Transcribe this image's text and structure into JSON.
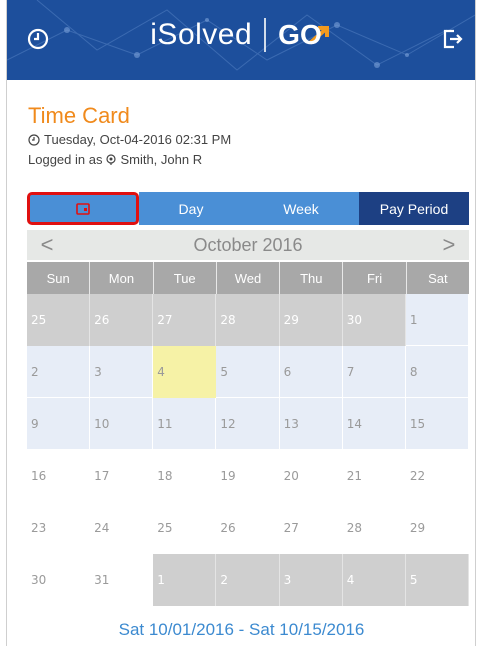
{
  "header": {
    "brand_text": "iSolved",
    "brand_go": "GO",
    "brand_color": "#1d4f9c",
    "left_icon": "clock-icon",
    "right_icon": "logout-icon"
  },
  "page": {
    "title": "Time Card",
    "datetime": "Tuesday, Oct-04-2016 02:31 PM",
    "logged_in_label": "Logged in as",
    "user": "Smith, John R"
  },
  "tabs": [
    {
      "label": "",
      "icon": "calendar-icon"
    },
    {
      "label": "Day"
    },
    {
      "label": "Week"
    },
    {
      "label": "Pay Period"
    }
  ],
  "calendar": {
    "month_label": "October 2016",
    "prev": "<",
    "next": ">",
    "weekdays": [
      "Sun",
      "Mon",
      "Tue",
      "Wed",
      "Thu",
      "Fri",
      "Sat"
    ],
    "weeks": [
      [
        {
          "d": "25",
          "s": "gray"
        },
        {
          "d": "26",
          "s": "gray"
        },
        {
          "d": "27",
          "s": "gray"
        },
        {
          "d": "28",
          "s": "gray"
        },
        {
          "d": "29",
          "s": "gray"
        },
        {
          "d": "30",
          "s": "gray"
        },
        {
          "d": "1",
          "s": "blue"
        }
      ],
      [
        {
          "d": "2",
          "s": "blue"
        },
        {
          "d": "3",
          "s": "blue"
        },
        {
          "d": "4",
          "s": "today"
        },
        {
          "d": "5",
          "s": "blue"
        },
        {
          "d": "6",
          "s": "blue"
        },
        {
          "d": "7",
          "s": "blue"
        },
        {
          "d": "8",
          "s": "blue"
        }
      ],
      [
        {
          "d": "9",
          "s": "blue"
        },
        {
          "d": "10",
          "s": "blue"
        },
        {
          "d": "11",
          "s": "blue"
        },
        {
          "d": "12",
          "s": "blue"
        },
        {
          "d": "13",
          "s": "blue"
        },
        {
          "d": "14",
          "s": "blue"
        },
        {
          "d": "15",
          "s": "blue"
        }
      ],
      [
        {
          "d": "16",
          "s": "white"
        },
        {
          "d": "17",
          "s": "white"
        },
        {
          "d": "18",
          "s": "white"
        },
        {
          "d": "19",
          "s": "white"
        },
        {
          "d": "20",
          "s": "white"
        },
        {
          "d": "21",
          "s": "white"
        },
        {
          "d": "22",
          "s": "white"
        }
      ],
      [
        {
          "d": "23",
          "s": "white"
        },
        {
          "d": "24",
          "s": "white"
        },
        {
          "d": "25",
          "s": "white"
        },
        {
          "d": "26",
          "s": "white"
        },
        {
          "d": "27",
          "s": "white"
        },
        {
          "d": "28",
          "s": "white"
        },
        {
          "d": "29",
          "s": "white"
        }
      ],
      [
        {
          "d": "30",
          "s": "white"
        },
        {
          "d": "31",
          "s": "white"
        },
        {
          "d": "1",
          "s": "gray"
        },
        {
          "d": "2",
          "s": "gray"
        },
        {
          "d": "3",
          "s": "gray"
        },
        {
          "d": "4",
          "s": "gray"
        },
        {
          "d": "5",
          "s": "gray"
        }
      ]
    ]
  },
  "pay_period_range": "Sat 10/01/2016 - Sat 10/15/2016"
}
